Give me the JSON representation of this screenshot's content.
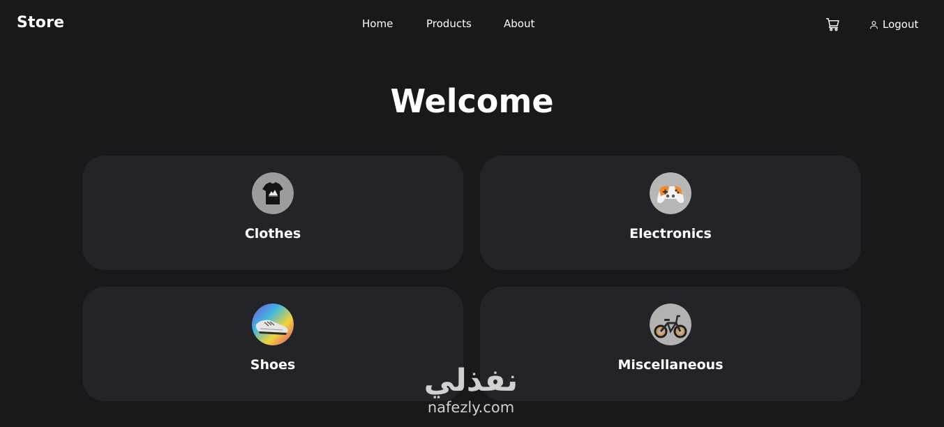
{
  "nav": {
    "brand": "Store",
    "links": [
      "Home",
      "Products",
      "About"
    ],
    "logout_label": "Logout"
  },
  "main": {
    "title": "Welcome",
    "categories": [
      {
        "label": "Clothes",
        "image": "tshirt-image"
      },
      {
        "label": "Electronics",
        "image": "game-controller-image"
      },
      {
        "label": "Shoes",
        "image": "sneakers-image"
      },
      {
        "label": "Miscellaneous",
        "image": "e-bike-image"
      }
    ]
  },
  "watermark": {
    "arabic": "نفذلي",
    "latin": "nafezly.com"
  },
  "colors": {
    "background": "#19191b",
    "card": "#222428",
    "text": "#ffffff"
  }
}
